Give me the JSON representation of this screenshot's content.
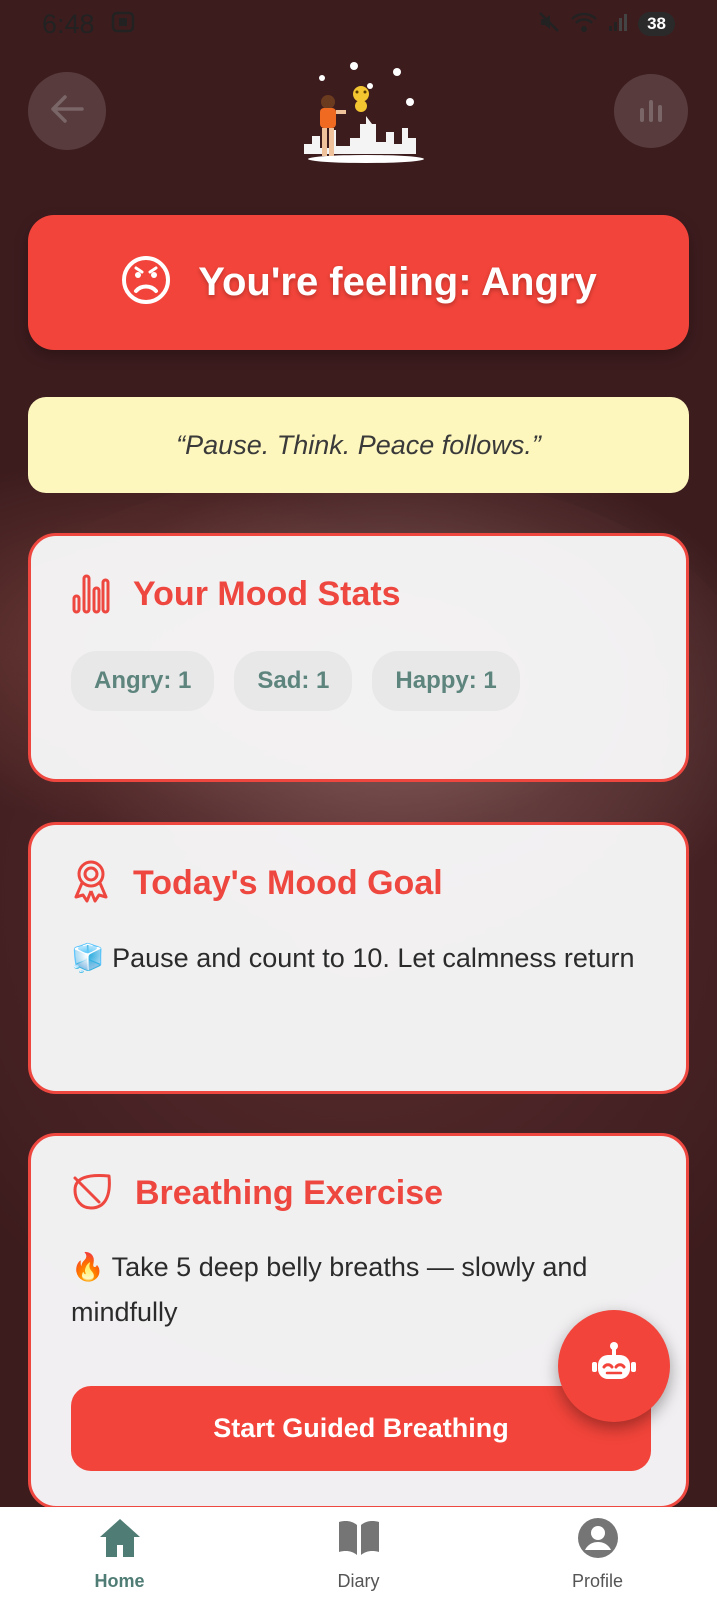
{
  "status_bar": {
    "time": "6:48",
    "battery": "38"
  },
  "colors": {
    "accent": "#f2443a",
    "quote_bg": "#fdf7bd",
    "chip_text": "#5d857d",
    "nav_active": "#4f7c74"
  },
  "header": {
    "back_icon": "arrow-left-icon",
    "stats_icon": "bar-chart-icon"
  },
  "mood_banner": {
    "icon": "angry-face-icon",
    "text": "You're feeling: Angry"
  },
  "quote": {
    "text": "“Pause. Think. Peace follows.”"
  },
  "mood_stats": {
    "icon": "bar-chart-icon",
    "title": "Your Mood Stats",
    "chips": [
      "Angry: 1",
      "Sad: 1",
      "Happy: 1"
    ]
  },
  "mood_goal": {
    "icon": "award-icon",
    "title": "Today's Mood Goal",
    "emoji": "🧊",
    "text": "Pause and count to 10. Let calmness return"
  },
  "breathing": {
    "icon": "leaf-icon",
    "title": "Breathing Exercise",
    "emoji": "🔥",
    "text": "Take 5 deep belly breaths — slowly and mindfully",
    "button": "Start Guided Breathing"
  },
  "fab": {
    "icon": "robot-icon"
  },
  "bottom_nav": {
    "items": [
      {
        "label": "Home",
        "icon": "home-icon",
        "active": true
      },
      {
        "label": "Diary",
        "icon": "book-icon",
        "active": false
      },
      {
        "label": "Profile",
        "icon": "account-icon",
        "active": false
      }
    ]
  }
}
